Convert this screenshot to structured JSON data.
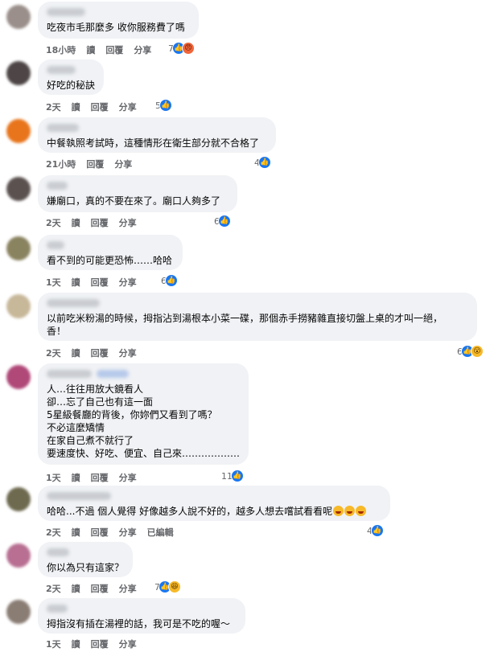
{
  "icons": {
    "like": "like-icon",
    "angry": "angry-icon",
    "wow": "wow-icon",
    "haha": "haha-icon"
  },
  "colors": {
    "accent": "#1877f2",
    "bubble": "#f0f2f5",
    "meta": "#65676b"
  },
  "labels": {
    "reply": "回覆",
    "share": "分享",
    "read": "讀",
    "edited": "已編輯"
  },
  "comments": [
    {
      "text": "吃夜市毛那麼多 收你服務費了嗎",
      "time": "18小時",
      "reactions": "7",
      "reaction_types": [
        "like",
        "angry"
      ]
    },
    {
      "text": "好吃的秘訣",
      "time": "2天",
      "reactions": "5",
      "reaction_types": [
        "like"
      ]
    },
    {
      "text": "中餐執照考試時，這種情形在衛生部分就不合格了",
      "time": "21小時",
      "reactions": "4",
      "reaction_types": [
        "like"
      ]
    },
    {
      "text": "嫌廟口，真的不要在來了。廟口人夠多了",
      "time": "2天",
      "reactions": "6",
      "reaction_types": [
        "like"
      ]
    },
    {
      "text": "看不到的可能更恐怖……哈哈",
      "time": "1天",
      "reactions": "6",
      "reaction_types": [
        "like"
      ]
    },
    {
      "text": "以前吃米粉湯的時候，拇指沾到湯根本小菜一碟，那個赤手撈豬雜直接切盤上桌的才叫一絕，\n香！",
      "time": "2天",
      "reactions": "6",
      "reaction_types": [
        "like",
        "wow"
      ]
    },
    {
      "text": "人…往往用放大鏡看人\n卻…忘了自己也有這一面\n5星級餐廳的背後，你妳們又看到了嗎？\n不必這麼矯情\n在家自己煮不就行了\n要速度快、好吃、便宜、自己來………………",
      "time": "1天",
      "reactions": "11",
      "reaction_types": [
        "like"
      ]
    },
    {
      "text": "哈哈...不過 個人覺得 好像越多人說不好的，越多人想去嚐試看看呢",
      "time": "2天",
      "reactions": "4",
      "reaction_types": [
        "like"
      ],
      "edited": true
    },
    {
      "text": "你以為只有這家？",
      "time": "2天",
      "reactions": "7",
      "reaction_types": [
        "like",
        "haha"
      ]
    },
    {
      "text": "拇指沒有插在湯裡的話，我可是不吃的喔～",
      "time": "1天",
      "reactions": "",
      "reaction_types": []
    }
  ]
}
